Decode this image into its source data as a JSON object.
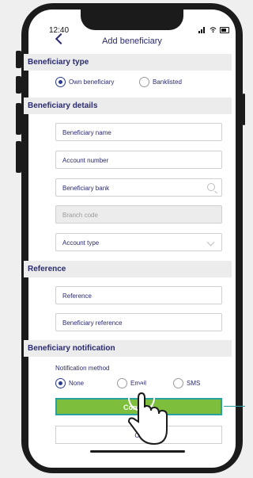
{
  "status": {
    "time": "12:40"
  },
  "header": {
    "title": "Add beneficiary"
  },
  "beneficiary_type": {
    "title": "Beneficiary type",
    "options": [
      {
        "label": "Own beneficiary",
        "selected": true
      },
      {
        "label": "Banklisted",
        "selected": false
      }
    ]
  },
  "beneficiary_details": {
    "title": "Beneficiary details",
    "fields": {
      "name": "Beneficiary name",
      "account_number": "Account number",
      "bank": "Beneficiary bank",
      "branch": "Branch code",
      "account_type": "Account type"
    }
  },
  "reference": {
    "title": "Reference",
    "fields": {
      "reference": "Reference",
      "beneficiary_reference": "Beneficiary reference"
    }
  },
  "notification": {
    "title": "Beneficiary notification",
    "method_label": "Notification method",
    "options": [
      {
        "label": "None",
        "selected": true
      },
      {
        "label": "Email",
        "selected": false
      },
      {
        "label": "SMS",
        "selected": false
      }
    ]
  },
  "actions": {
    "continue": "Continue",
    "cancel": "Ca"
  },
  "colors": {
    "accent": "#2a2a6e",
    "continue_bg": "#7dbf3c",
    "highlight": "#2aa0a4"
  }
}
